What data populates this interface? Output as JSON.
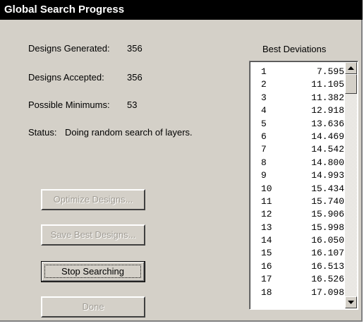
{
  "window": {
    "title": "Global Search Progress"
  },
  "info": {
    "designs_generated_label": "Designs Generated:",
    "designs_generated_value": "356",
    "designs_accepted_label": "Designs Accepted:",
    "designs_accepted_value": "356",
    "possible_minimums_label": "Possible Minimums:",
    "possible_minimums_value": "53",
    "status_label": "Status:",
    "status_value": "Doing random search of layers."
  },
  "buttons": {
    "optimize": {
      "label": "Optimize Designs...",
      "enabled": false
    },
    "save_best": {
      "label": "Save Best Designs...",
      "enabled": false
    },
    "stop": {
      "label": "Stop Searching",
      "enabled": true
    },
    "done": {
      "label": "Done",
      "enabled": false
    }
  },
  "best_deviations": {
    "title": "Best Deviations",
    "rows": [
      {
        "rank": "1",
        "value": "7.595"
      },
      {
        "rank": "2",
        "value": "11.105"
      },
      {
        "rank": "3",
        "value": "11.382"
      },
      {
        "rank": "4",
        "value": "12.918"
      },
      {
        "rank": "5",
        "value": "13.636"
      },
      {
        "rank": "6",
        "value": "14.469"
      },
      {
        "rank": "7",
        "value": "14.542"
      },
      {
        "rank": "8",
        "value": "14.800"
      },
      {
        "rank": "9",
        "value": "14.993"
      },
      {
        "rank": "10",
        "value": "15.434"
      },
      {
        "rank": "11",
        "value": "15.740"
      },
      {
        "rank": "12",
        "value": "15.906"
      },
      {
        "rank": "13",
        "value": "15.998"
      },
      {
        "rank": "14",
        "value": "16.050"
      },
      {
        "rank": "15",
        "value": "16.107"
      },
      {
        "rank": "16",
        "value": "16.513"
      },
      {
        "rank": "17",
        "value": "16.526"
      },
      {
        "rank": "18",
        "value": "17.098"
      }
    ]
  },
  "colors": {
    "titlebar": "#000000",
    "title_text": "#ffffff",
    "dialog_face": "#d4d0c8",
    "disabled_text": "#a09c94"
  }
}
